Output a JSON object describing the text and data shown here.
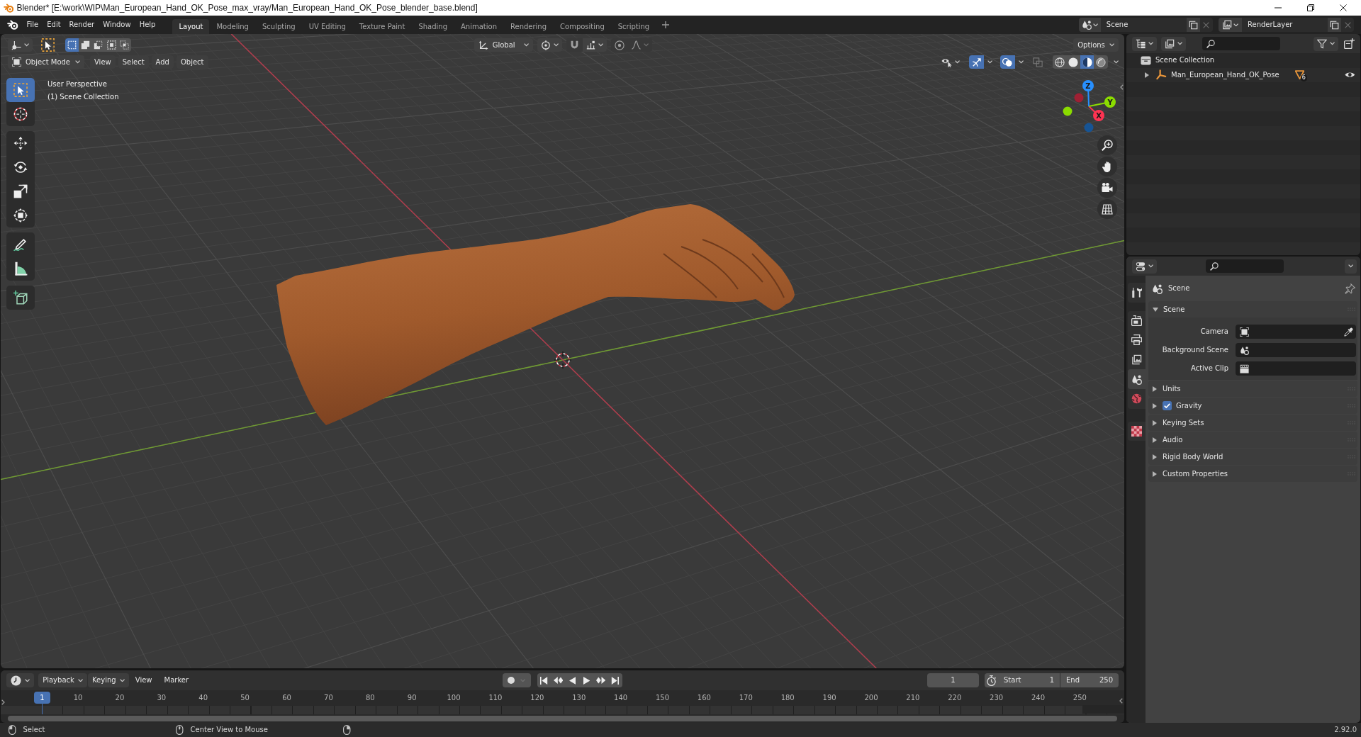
{
  "window": {
    "title": "Blender* [E:\\work\\WIP\\Man_European_Hand_OK_Pose_max_vray/Man_European_Hand_OK_Pose_blender_base.blend]"
  },
  "menu": [
    "File",
    "Edit",
    "Render",
    "Window",
    "Help"
  ],
  "workspaces": [
    {
      "label": "Layout",
      "selected": true
    },
    {
      "label": "Modeling",
      "selected": false
    },
    {
      "label": "Sculpting",
      "selected": false
    },
    {
      "label": "UV Editing",
      "selected": false
    },
    {
      "label": "Texture Paint",
      "selected": false
    },
    {
      "label": "Shading",
      "selected": false
    },
    {
      "label": "Animation",
      "selected": false
    },
    {
      "label": "Rendering",
      "selected": false
    },
    {
      "label": "Compositing",
      "selected": false
    },
    {
      "label": "Scripting",
      "selected": false
    }
  ],
  "scene": {
    "value": "Scene"
  },
  "view_layer": {
    "value": "RenderLayer"
  },
  "viewport": {
    "tool_header": {
      "select_modes": [
        {
          "selected": true
        },
        {
          "selected": false
        },
        {
          "selected": false
        },
        {
          "selected": false
        },
        {
          "selected": false
        }
      ],
      "transform_orientation": "Global",
      "snap": false,
      "proportional_editing": false,
      "options": "Options"
    },
    "header": {
      "mode": "Object Mode",
      "menus": [
        "View",
        "Select",
        "Add",
        "Object"
      ],
      "toggles": [
        {
          "kind": "gizmos",
          "on": true
        },
        {
          "kind": "overlays",
          "on": true
        },
        {
          "kind": "xray",
          "on": false
        }
      ],
      "shading": [
        {
          "kind": "wireframe",
          "selected": false
        },
        {
          "kind": "solid",
          "selected": false
        },
        {
          "kind": "material",
          "selected": true
        },
        {
          "kind": "rendered",
          "selected": false
        }
      ]
    },
    "overlay_text": [
      "User Perspective",
      "(1) Scene Collection"
    ],
    "toolbar": [
      [
        {
          "kind": "select_box",
          "selected": true
        },
        {
          "kind": "cursor",
          "selected": false
        }
      ],
      [
        {
          "kind": "move",
          "selected": false
        },
        {
          "kind": "rotate",
          "selected": false
        },
        {
          "kind": "scale",
          "selected": false
        },
        {
          "kind": "transform",
          "selected": false
        }
      ],
      [
        {
          "kind": "annotate",
          "selected": false
        },
        {
          "kind": "measure",
          "selected": false
        }
      ],
      [
        {
          "kind": "add_cube",
          "selected": false
        }
      ]
    ],
    "gizmo": {
      "axes": [
        {
          "label": "X",
          "color": "#ff3352"
        },
        {
          "label": "Y",
          "color": "#8bdc00"
        },
        {
          "label": "Z",
          "color": "#2890ff"
        }
      ]
    }
  },
  "outliner": {
    "tree": [
      {
        "label": "Scene Collection",
        "kind": "collection",
        "children": [
          {
            "label": "Man_European_Hand_OK_Pose",
            "kind": "empty",
            "expanded": false,
            "badge": "6",
            "visible": true
          }
        ]
      }
    ]
  },
  "properties": {
    "tabs": [
      [
        {
          "kind": "tool",
          "selected": false
        }
      ],
      [
        {
          "kind": "render",
          "selected": false
        },
        {
          "kind": "output",
          "selected": false
        },
        {
          "kind": "view_layer",
          "selected": false
        },
        {
          "kind": "scene",
          "selected": true
        },
        {
          "kind": "world",
          "selected": false
        }
      ],
      [
        {
          "kind": "texture",
          "selected": false
        }
      ]
    ],
    "context": "Scene",
    "panels": [
      {
        "title": "Scene",
        "expanded": true,
        "fields": [
          {
            "label": "Camera",
            "kind": "camera"
          },
          {
            "label": "Background Scene",
            "kind": "scene"
          },
          {
            "label": "Active Clip",
            "kind": "clip"
          }
        ]
      },
      {
        "title": "Units",
        "expanded": false
      },
      {
        "title": "Gravity",
        "expanded": false,
        "checked": true
      },
      {
        "title": "Keying Sets",
        "expanded": false
      },
      {
        "title": "Audio",
        "expanded": false
      },
      {
        "title": "Rigid Body World",
        "expanded": false
      },
      {
        "title": "Custom Properties",
        "expanded": false
      }
    ]
  },
  "timeline": {
    "menus": [
      {
        "label": "Playback",
        "kind": "dropdown"
      },
      {
        "label": "Keying",
        "kind": "dropdown"
      },
      {
        "label": "View",
        "kind": "menu"
      },
      {
        "label": "Marker",
        "kind": "menu"
      }
    ],
    "auto_keying": false,
    "current_frame": "1",
    "preview_range": false,
    "start": {
      "label": "Start",
      "value": "1"
    },
    "end": {
      "label": "End",
      "value": "250"
    },
    "playhead": "1",
    "ruler": [
      "10",
      "20",
      "30",
      "40",
      "50",
      "60",
      "70",
      "80",
      "90",
      "100",
      "110",
      "120",
      "130",
      "140",
      "150",
      "160",
      "170",
      "180",
      "190",
      "200",
      "210",
      "220",
      "230",
      "240",
      "250"
    ]
  },
  "status_bar": {
    "hints": [
      {
        "kind": "left_click",
        "label": "Select"
      },
      {
        "kind": "middle_click",
        "label": "Center View to Mouse"
      },
      {
        "kind": "right_click"
      }
    ],
    "version": "2.92.0"
  }
}
